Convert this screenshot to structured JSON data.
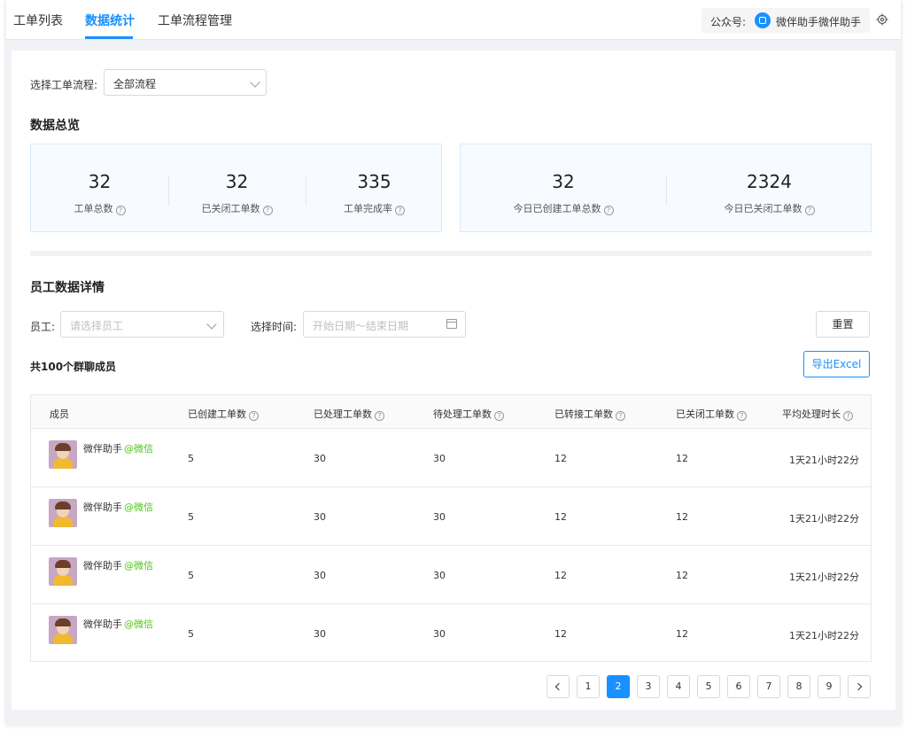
{
  "tabs": [
    "工单列表",
    "数据统计",
    "工单流程管理"
  ],
  "account": {
    "label": "公众号:",
    "name": "微伴助手微伴助手"
  },
  "filter": {
    "label": "选择工单流程:",
    "value": "全部流程"
  },
  "overview": {
    "title": "数据总览",
    "left_stats": [
      {
        "value": "32",
        "caption": "工单总数"
      },
      {
        "value": "32",
        "caption": "已关闭工单数"
      },
      {
        "value": "335",
        "caption": "工单完成率"
      }
    ],
    "right_stats": [
      {
        "value": "32",
        "caption": "今日已创建工单总数"
      },
      {
        "value": "2324",
        "caption": "今日已关闭工单数"
      }
    ]
  },
  "detail": {
    "title": "员工数据详情",
    "employee_label": "员工:",
    "employee_placeholder": "请选择员工",
    "time_label": "选择时间:",
    "time_placeholder": "开始日期～结束日期",
    "reset_label": "重置",
    "export_label": "导出Excel",
    "count_text": "共100个群聊成员"
  },
  "table": {
    "headers": [
      "成员",
      "已创建工单数",
      "已处理工单数",
      "待处理工单数",
      "已转接工单数",
      "已关闭工单数",
      "平均处理时长"
    ],
    "rows": [
      {
        "name": "微伴助手",
        "tag": "@微信",
        "created": "5",
        "handled": "30",
        "pending": "30",
        "transferred": "12",
        "closed": "12",
        "avg_time": "1天21小时22分"
      },
      {
        "name": "微伴助手",
        "tag": "@微信",
        "created": "5",
        "handled": "30",
        "pending": "30",
        "transferred": "12",
        "closed": "12",
        "avg_time": "1天21小时22分"
      },
      {
        "name": "微伴助手",
        "tag": "@微信",
        "created": "5",
        "handled": "30",
        "pending": "30",
        "transferred": "12",
        "closed": "12",
        "avg_time": "1天21小时22分"
      },
      {
        "name": "微伴助手",
        "tag": "@微信",
        "created": "5",
        "handled": "30",
        "pending": "30",
        "transferred": "12",
        "closed": "12",
        "avg_time": "1天21小时22分"
      }
    ]
  },
  "pagination": {
    "pages": [
      "1",
      "2",
      "3",
      "4",
      "5",
      "6",
      "7",
      "8",
      "9"
    ],
    "current": "2"
  },
  "icons": {
    "help": "?",
    "settings": "gear-icon",
    "calendar": "calendar-icon",
    "prev": "chevron-left-icon",
    "next": "chevron-right-icon"
  },
  "colors": {
    "accent": "#1890ff",
    "tag": "#52c41a"
  }
}
